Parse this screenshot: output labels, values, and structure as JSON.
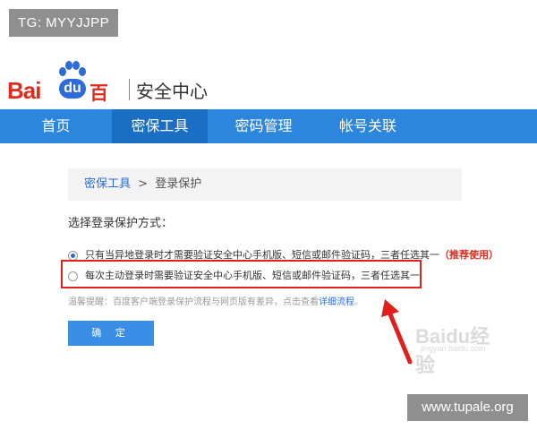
{
  "overlay_tag": "TG: MYYJJPP",
  "logo": {
    "latin": "Bai",
    "du": "du",
    "chinese": "百度"
  },
  "site_title": "安全中心",
  "nav": [
    {
      "label": "首页",
      "active": false
    },
    {
      "label": "密保工具",
      "active": true
    },
    {
      "label": "密码管理",
      "active": false
    },
    {
      "label": "帐号关联",
      "active": false
    }
  ],
  "breadcrumb": {
    "parent": "密保工具",
    "separator": ">",
    "current": "登录保护"
  },
  "prompt": "选择登录保护方式：",
  "options": [
    {
      "text": "只有当异地登录时才需要验证安全中心手机版、短信或邮件验证码，三者任选其一",
      "badge": "（推荐使用）",
      "checked": true
    },
    {
      "text": "每次主动登录时需要验证安全中心手机版、短信或邮件验证码，三者任选其一",
      "checked": false
    }
  ],
  "note": {
    "text": "温馨提醒：百度客户端登录保护流程与网页版有差异，点击查看",
    "link": "详细流程",
    "end": "。"
  },
  "confirm_label": "确 定",
  "watermark": {
    "text": "Baidu经验",
    "sub": "jingyan.baidu.com"
  },
  "site_tag": "www.tupale.org",
  "colors": {
    "nav": "#2d86dd",
    "nav_active": "#1a6fc4",
    "brand_red": "#e02b1c",
    "highlight": "#e0201c",
    "button": "#3a8ee6"
  }
}
